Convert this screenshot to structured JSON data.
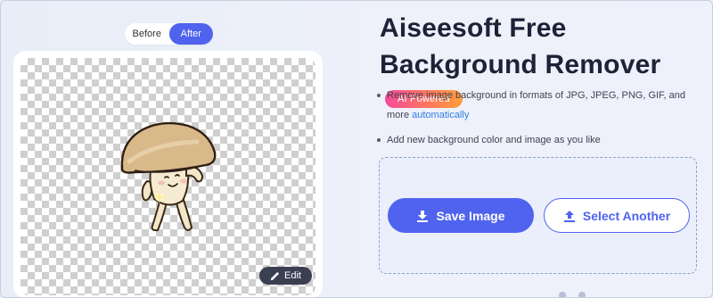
{
  "toggle": {
    "before_label": "Before",
    "after_label": "After",
    "selected": "After"
  },
  "preview": {
    "edit_label": "Edit"
  },
  "title": {
    "text": "Aiseesoft Free Background Remover",
    "badge": "AI Powered"
  },
  "features": [
    {
      "text": "Remove image background in formats of JPG, JPEG, PNG, GIF, and more",
      "highlight": "automatically"
    },
    {
      "text": "Add new background color and image as you like"
    }
  ],
  "actions": {
    "save_label": "Save Image",
    "select_label": "Select Another"
  },
  "colors": {
    "accent": "#4f63ee",
    "title": "#1d2237",
    "link": "#2f7ee6",
    "edit_bg": "#3a3f52"
  },
  "icons": {
    "save": "download-icon",
    "select": "upload-icon",
    "edit": "brush-icon"
  }
}
